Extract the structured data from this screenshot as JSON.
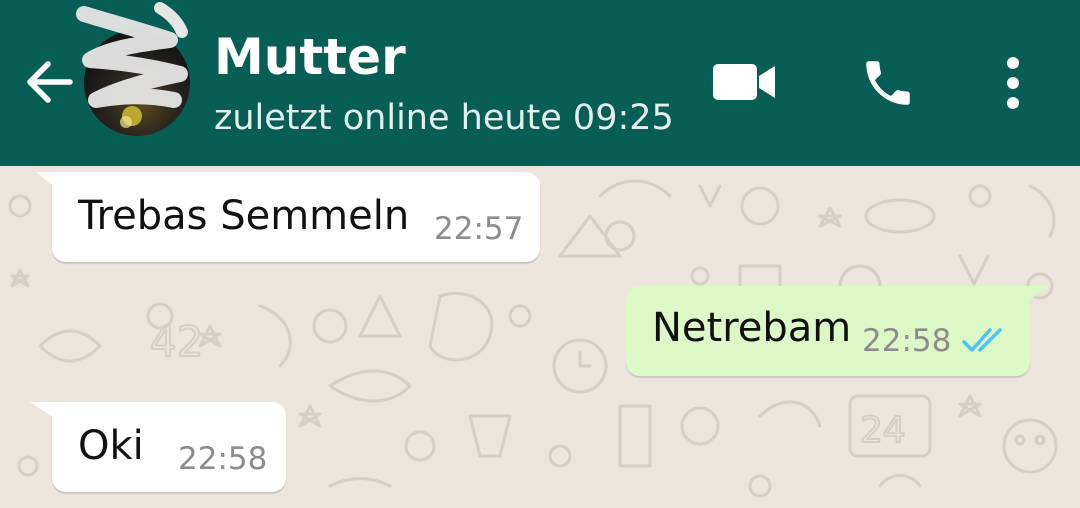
{
  "header": {
    "contact_name": "Mutter",
    "last_seen": "zuletzt online heute 09:25",
    "icons": {
      "back": "arrow-back-icon",
      "video": "video-call-icon",
      "call": "phone-icon",
      "more": "more-vertical-icon"
    }
  },
  "messages": [
    {
      "direction": "incoming",
      "text": "Trebas Semmeln",
      "time": "22:57"
    },
    {
      "direction": "outgoing",
      "text": "Netrebam",
      "time": "22:58",
      "status": "read"
    },
    {
      "direction": "incoming",
      "text": "Oki",
      "time": "22:58"
    }
  ],
  "colors": {
    "header": "#075e54",
    "chat_background": "#ece5dd",
    "incoming_bubble": "#ffffff",
    "outgoing_bubble": "#dcf8c6",
    "read_ticks": "#4fc3f7",
    "timestamp": "#8c8c8c"
  }
}
